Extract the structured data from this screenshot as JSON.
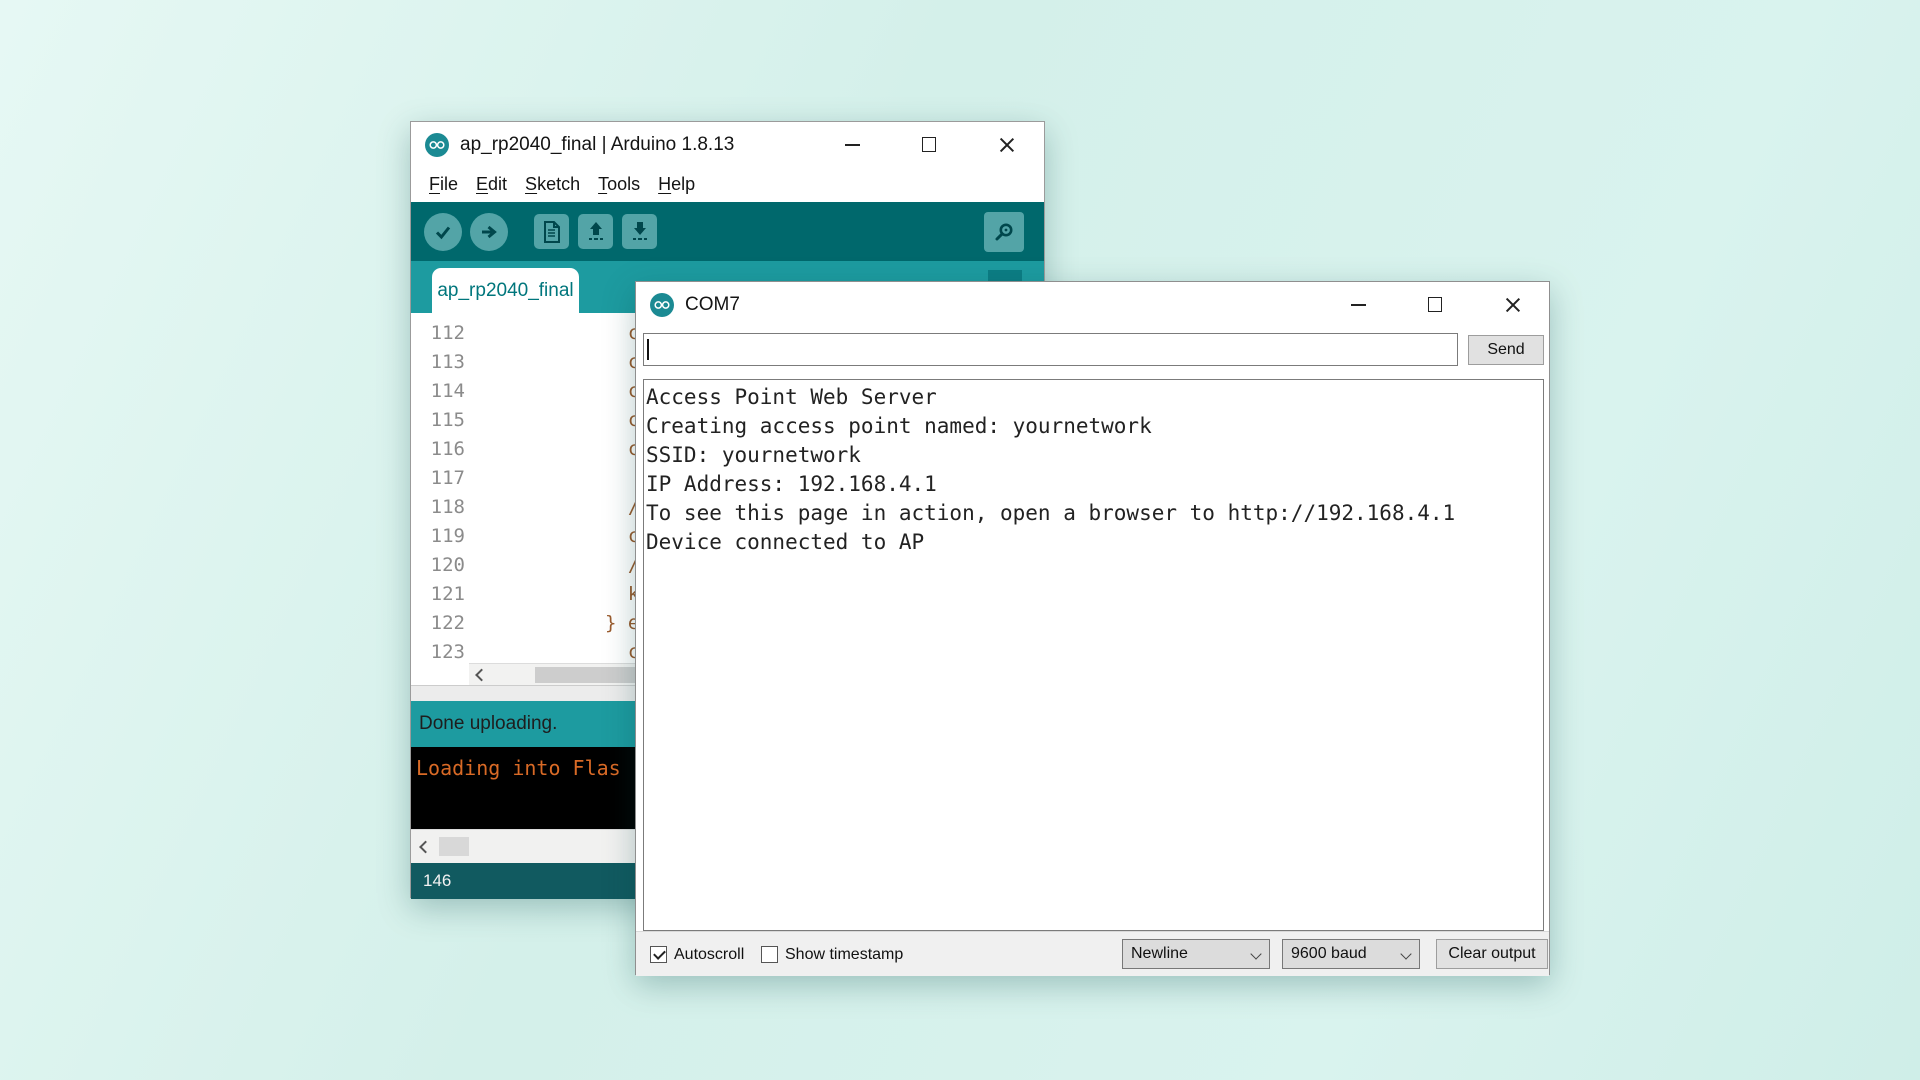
{
  "colors": {
    "toolbar_teal": "#00686c",
    "tabstrip_teal": "#1d9ba0",
    "bottombar_teal": "#115a60",
    "icon_fill_teal": "#53a4a7",
    "console_text_orange": "#d96a26",
    "page_background_mint": "#d9f3ee"
  },
  "ide": {
    "title": "ap_rp2040_final | Arduino 1.8.13",
    "menu": [
      "File",
      "Edit",
      "Sketch",
      "Tools",
      "Help"
    ],
    "tab_label": "ap_rp2040_final",
    "editor": {
      "lines": [
        {
          "num": "112",
          "code": "  c"
        },
        {
          "num": "113",
          "code": "  c"
        },
        {
          "num": "114",
          "code": "  c"
        },
        {
          "num": "115",
          "code": "  c"
        },
        {
          "num": "116",
          "code": "  c"
        },
        {
          "num": "117",
          "code": ""
        },
        {
          "num": "118",
          "code": "  /"
        },
        {
          "num": "119",
          "code": "  c"
        },
        {
          "num": "120",
          "code": "  /"
        },
        {
          "num": "121",
          "code": "  k"
        },
        {
          "num": "122",
          "code": "} e"
        },
        {
          "num": "123",
          "code": "  c"
        }
      ]
    },
    "status_message": "Done uploading.",
    "console_text": "Loading into Flas",
    "statusbar_line_number": "146"
  },
  "serial": {
    "title": "COM7",
    "input_value": "",
    "send_label": "Send",
    "output_lines": [
      "Access Point Web Server",
      "Creating access point named: yournetwork",
      "SSID: yournetwork",
      "IP Address: 192.168.4.1",
      "To see this page in action, open a browser to http://192.168.4.1",
      "Device connected to AP"
    ],
    "autoscroll_label": "Autoscroll",
    "show_timestamp_label": "Show timestamp",
    "line_ending_selected": "Newline",
    "baud_selected": "9600 baud",
    "clear_label": "Clear output"
  }
}
